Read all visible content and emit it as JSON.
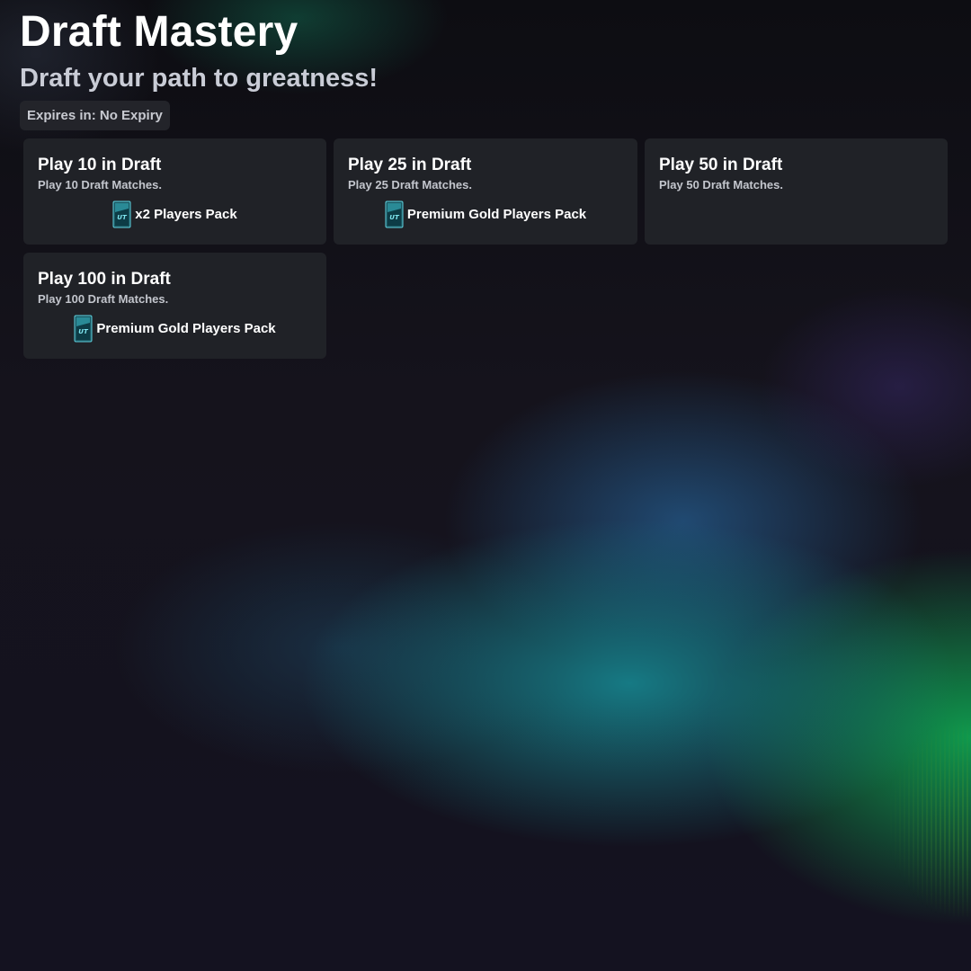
{
  "header": {
    "title": "Draft Mastery",
    "subtitle": "Draft your path to greatness!",
    "expiry": "Expires in: No Expiry"
  },
  "objectives": [
    {
      "title": "Play 10 in Draft",
      "description": "Play 10 Draft Matches.",
      "reward": "x2 Players Pack",
      "reward_icon": "ut-pack-icon"
    },
    {
      "title": "Play 25 in Draft",
      "description": "Play 25 Draft Matches.",
      "reward": "Premium Gold Players Pack",
      "reward_icon": "ut-pack-icon"
    },
    {
      "title": "Play 50 in Draft",
      "description": "Play 50 Draft Matches."
    },
    {
      "title": "Play 100 in Draft",
      "description": "Play 100 Draft Matches.",
      "reward": "Premium Gold Players Pack",
      "reward_icon": "ut-pack-icon"
    }
  ],
  "colors": {
    "background": "#121119",
    "card": "#202227",
    "badge": "#23242a",
    "accent_teal": "#168c96",
    "accent_green": "#0fa050"
  }
}
